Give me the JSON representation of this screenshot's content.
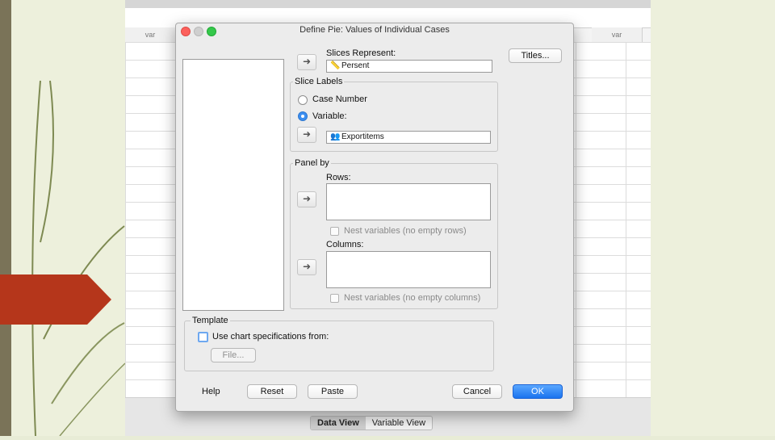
{
  "sheet": {
    "col_left": "var",
    "col_right": "var",
    "tabs": [
      "Data View",
      "Variable View"
    ]
  },
  "dialog": {
    "title": "Define Pie: Values of Individual Cases",
    "slices_represent_label": "Slices Represent:",
    "slices_represent_value": "Persent",
    "titles_button": "Titles...",
    "slice_labels": {
      "title": "Slice Labels",
      "case_number": "Case Number",
      "variable": "Variable:",
      "variable_value": "Exportitems",
      "selected": "variable"
    },
    "panel_by": {
      "title": "Panel by",
      "rows_label": "Rows:",
      "nest_rows": "Nest variables (no empty rows)",
      "columns_label": "Columns:",
      "nest_columns": "Nest variables (no empty columns)"
    },
    "template": {
      "title": "Template",
      "use_spec": "Use chart specifications from:",
      "file_button": "File..."
    },
    "buttons": {
      "help": "Help",
      "reset": "Reset",
      "paste": "Paste",
      "cancel": "Cancel",
      "ok": "OK"
    }
  },
  "colors": {
    "accent_red": "#b5361b",
    "ok_blue": "#1a73ef",
    "slide_bar": "#7a7358"
  },
  "icons": [
    "arrow-right-icon",
    "ruler-icon",
    "nominal-variable-icon"
  ]
}
